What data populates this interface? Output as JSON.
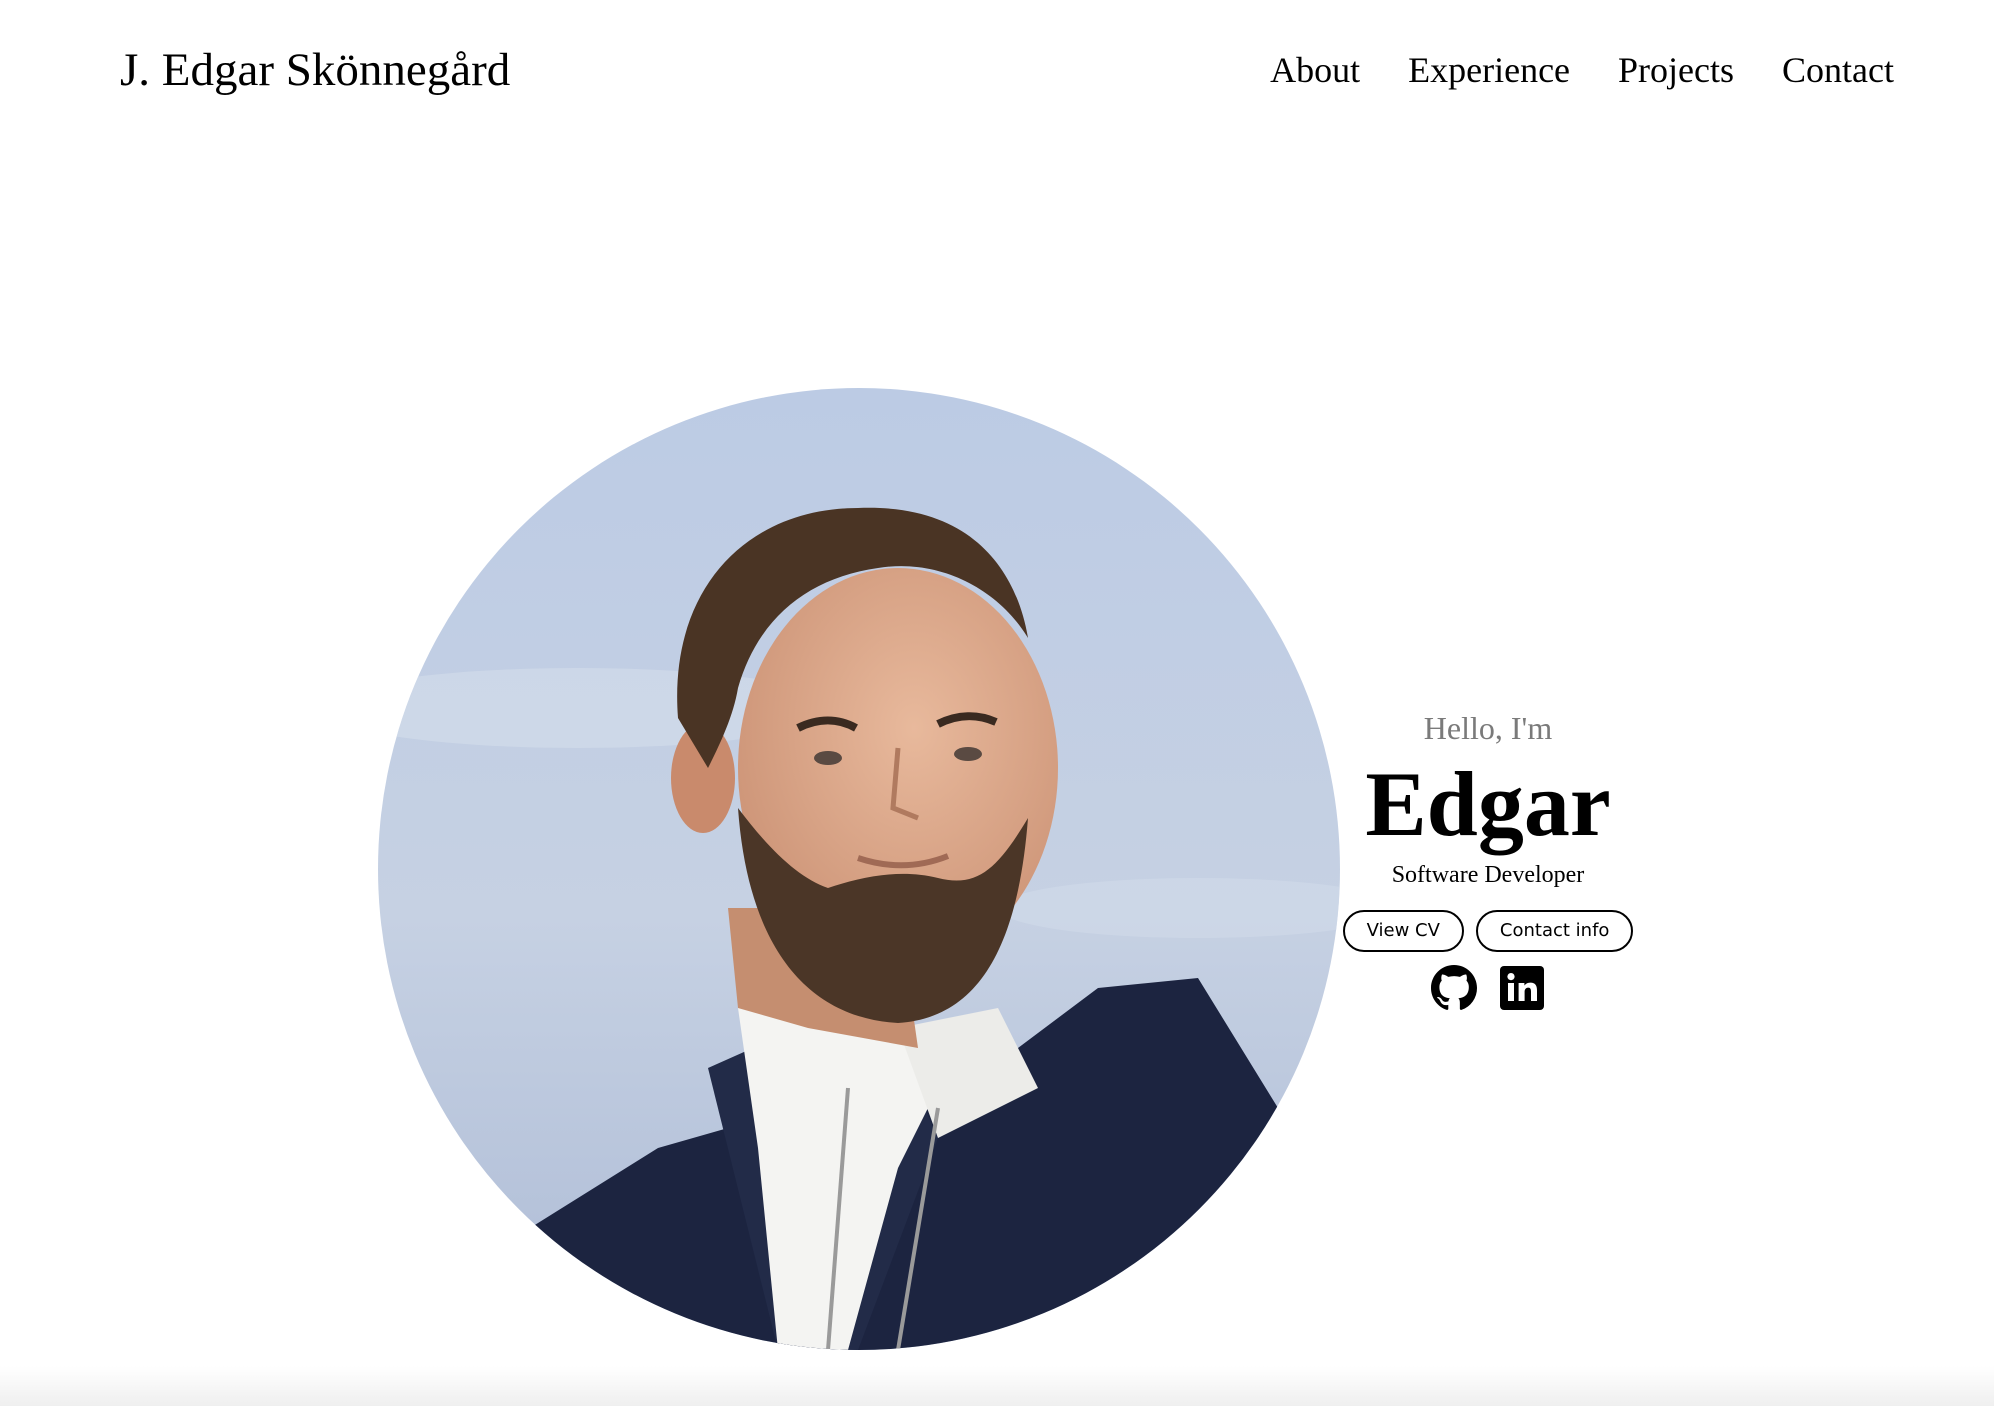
{
  "header": {
    "brand": "J. Edgar Skönnegård",
    "nav": [
      {
        "label": "About"
      },
      {
        "label": "Experience"
      },
      {
        "label": "Projects"
      },
      {
        "label": "Contact"
      }
    ]
  },
  "hero": {
    "greeting": "Hello, I'm",
    "name": "Edgar",
    "role": "Software Developer",
    "buttons": {
      "cv_label": "View CV",
      "contact_label": "Contact info"
    },
    "social_icons": [
      "github-icon",
      "linkedin-icon"
    ]
  }
}
